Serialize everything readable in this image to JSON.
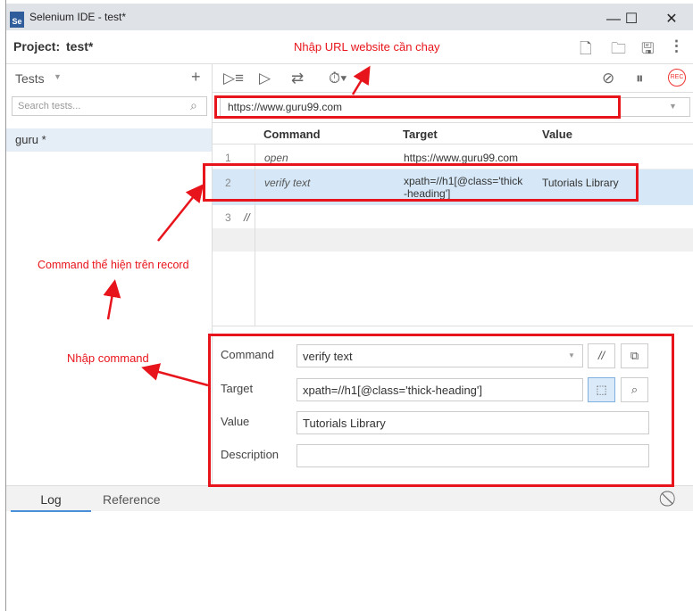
{
  "window": {
    "title": "Selenium IDE - test*",
    "logo": "Se"
  },
  "project": {
    "label": "Project:",
    "name": "test*"
  },
  "sidebar": {
    "header": "Tests",
    "search_placeholder": "Search tests...",
    "tests": [
      {
        "name": "guru *"
      }
    ]
  },
  "toolbar": {
    "url": "https://www.guru99.com",
    "rec": "REC"
  },
  "table": {
    "headers": [
      "Command",
      "Target",
      "Value"
    ],
    "rows": [
      {
        "num": "1",
        "command": "open",
        "target": "https://www.guru99.com",
        "value": ""
      },
      {
        "num": "2",
        "command": "verify text",
        "target": "xpath=//h1[@class='thick\n-heading']",
        "value": "Tutorials Library"
      },
      {
        "num": "3",
        "command": "//",
        "target": "",
        "value": ""
      }
    ]
  },
  "editor": {
    "command_label": "Command",
    "command_value": "verify text",
    "comment_btn": "//",
    "target_label": "Target",
    "target_value": "xpath=//h1[@class='thick-heading']",
    "value_label": "Value",
    "value_value": "Tutorials Library",
    "description_label": "Description",
    "description_value": ""
  },
  "bottom": {
    "tabs": [
      "Log",
      "Reference"
    ]
  },
  "annotations": {
    "url": "Nhập URL website cần chạy",
    "record": "Command thể hiện trên record",
    "command": "Nhập command"
  },
  "colors": {
    "annotation": "#e8141b",
    "selected_row": "#d6e8f7"
  }
}
